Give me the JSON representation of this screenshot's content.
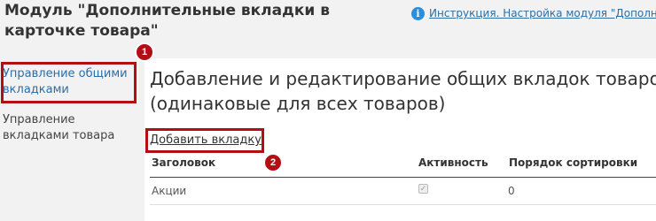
{
  "header": {
    "module_title": "Модуль \"Дополнительные вкладки в карточке товара\"",
    "help_link": "Инструкция. Настройка модуля \"Дополни",
    "info_icon_glyph": "i"
  },
  "sidebar": {
    "items": [
      {
        "label": "Управление общими вкладками",
        "active": true
      },
      {
        "label": "Управление вкладками товара",
        "active": false
      }
    ]
  },
  "annotations": {
    "badge_1": "1",
    "badge_2": "2",
    "highlight_color": "#b40e14"
  },
  "main": {
    "heading": "Добавление и редактирование общих вкладок товаров (одинаковые для всех товаров)",
    "heading_line1": "Добавление и редактирование общих вкладок товаров",
    "heading_line2": "(одинаковые для всех товаров)",
    "add_tab_label": "Добавить вкладку",
    "table": {
      "columns": [
        "Заголовок",
        "Активность",
        "Порядок сортировки"
      ],
      "rows": [
        {
          "title": "Акции",
          "active": true,
          "sort_order": "0"
        }
      ]
    }
  },
  "colors": {
    "link": "#2b6ea8",
    "panel_bg": "#f2f2f2"
  }
}
